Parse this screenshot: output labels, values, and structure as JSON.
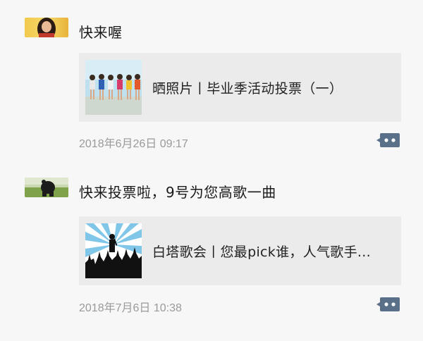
{
  "posts": [
    {
      "text": "快来喔",
      "card_title": "晒照片丨毕业季活动投票（一）",
      "time": "2018年6月26日 09:17"
    },
    {
      "text": "快来投票啦，9号为您高歌一曲",
      "card_title": "白塔歌会丨您最pick谁，人气歌手...",
      "time": "2018年7月6日 10:38"
    }
  ],
  "icons": {
    "comment": "comment-dots-icon"
  },
  "colors": {
    "background": "#f7f7f7",
    "card": "#ebebeb",
    "timestamp": "#9a9a9a",
    "comment_button": "#5a6f88"
  }
}
